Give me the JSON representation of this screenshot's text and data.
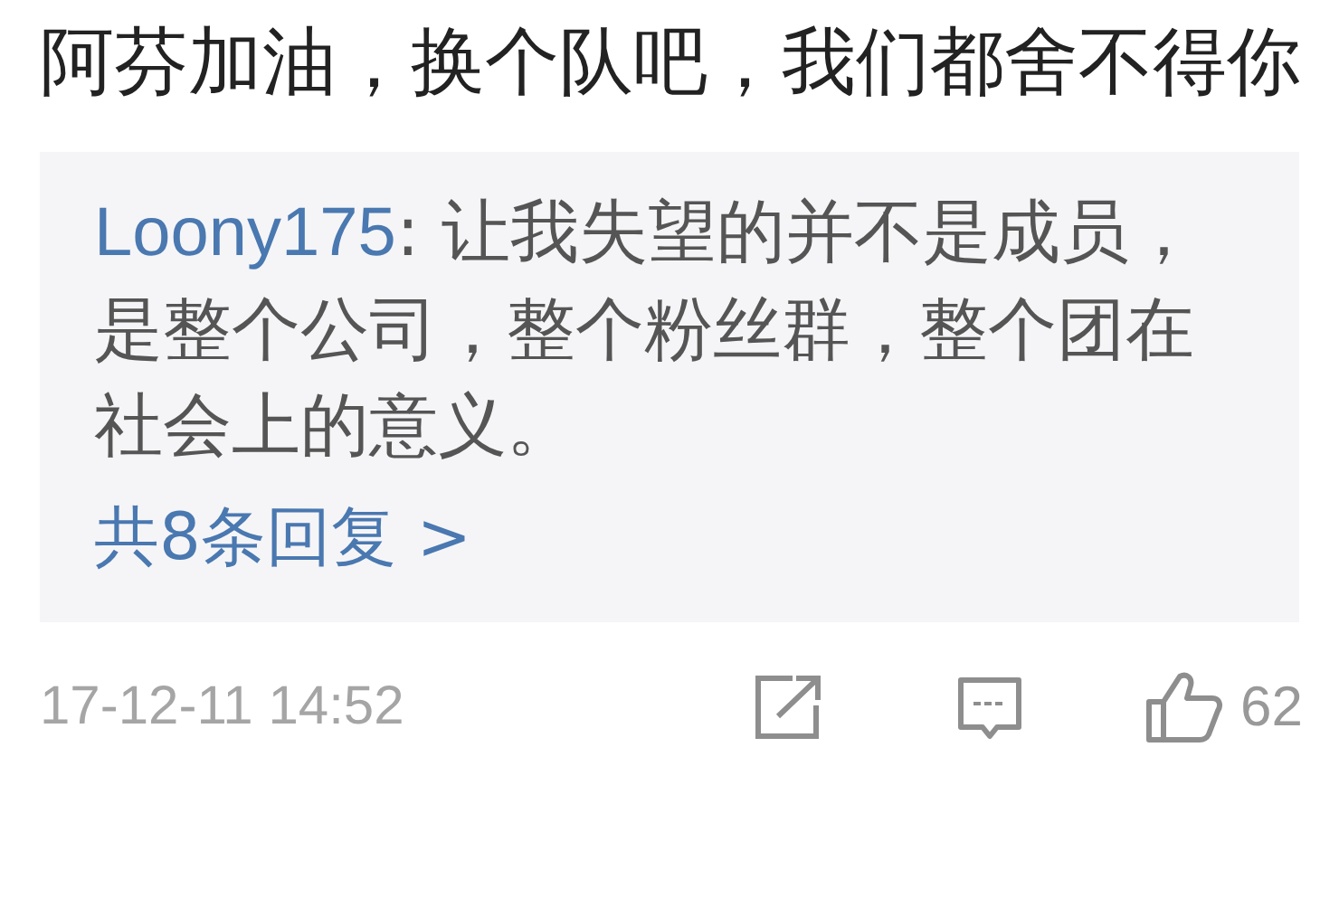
{
  "comment": {
    "text": "阿芬加油，换个队吧，我们都舍不得你"
  },
  "reply": {
    "author": "Loony175",
    "separator": ": ",
    "text": "让我失望的并不是成员，是整个公司，整个粉丝群，整个团在社会上的意义。",
    "more_link": "共8条回复 >"
  },
  "footer": {
    "time": "17-12-11 14:52",
    "likes": "62"
  }
}
